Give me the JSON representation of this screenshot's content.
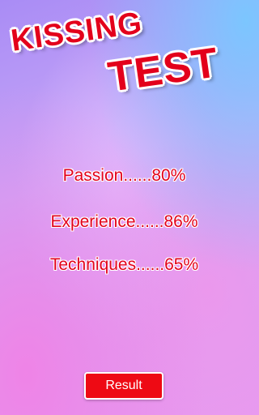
{
  "title": {
    "line1": "KISSING",
    "line2": "TEST"
  },
  "stats": [
    {
      "label": "Passion......80%"
    },
    {
      "label": "Experience......86%"
    },
    {
      "label": "Techniques......65%"
    }
  ],
  "result_button": {
    "label": "Result"
  },
  "colors": {
    "accent": "#e3001b",
    "button_bg": "#ee0a14",
    "outline": "#ffffff"
  }
}
